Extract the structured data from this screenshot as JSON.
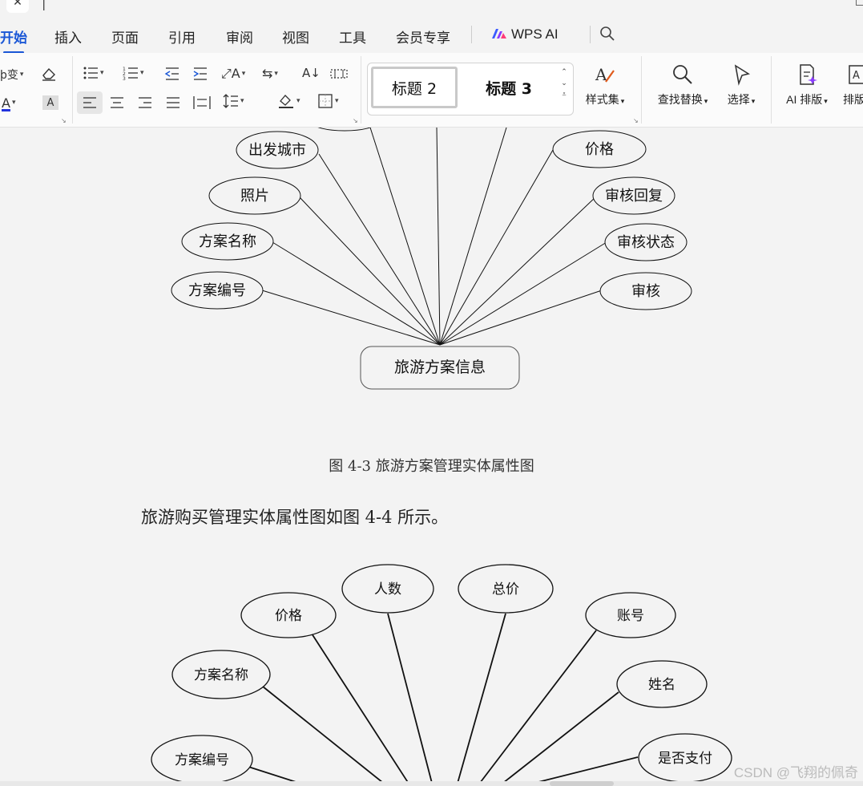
{
  "tabs": {
    "home": "开始",
    "insert": "插入",
    "page": "页面",
    "references": "引用",
    "review": "审阅",
    "view": "视图",
    "tools": "工具",
    "member": "会员专享",
    "wps_ai": "WPS AI"
  },
  "ribbon": {
    "style_heading2": "标题 2",
    "style_heading3": "标题 3",
    "style_set": "样式集",
    "find_replace": "查找替换",
    "select": "选择",
    "ai_layout": "AI 排版",
    "layout_cut": "排版"
  },
  "diagram1": {
    "entity": "旅游方案信息",
    "attrs": {
      "city": "出发城市",
      "photo": "照片",
      "plan_name": "方案名称",
      "plan_no": "方案编号",
      "price": "价格",
      "review_reply": "审核回复",
      "review_status": "审核状态",
      "review": "审核"
    }
  },
  "caption1": "图 4-3 旅游方案管理实体属性图",
  "paragraph": "旅游购买管理实体属性图如图 4-4 所示。",
  "diagram2": {
    "attrs": {
      "price": "价格",
      "people": "人数",
      "total": "总价",
      "account": "账号",
      "plan_name": "方案名称",
      "name": "姓名",
      "plan_no": "方案编号",
      "paid": "是否支付"
    }
  },
  "watermark": "CSDN @飞翔的佩奇",
  "colors": {
    "accent": "#1a57d6",
    "page_bg": "#f3f3f3",
    "ribbon_bg": "#fbfbfb"
  }
}
